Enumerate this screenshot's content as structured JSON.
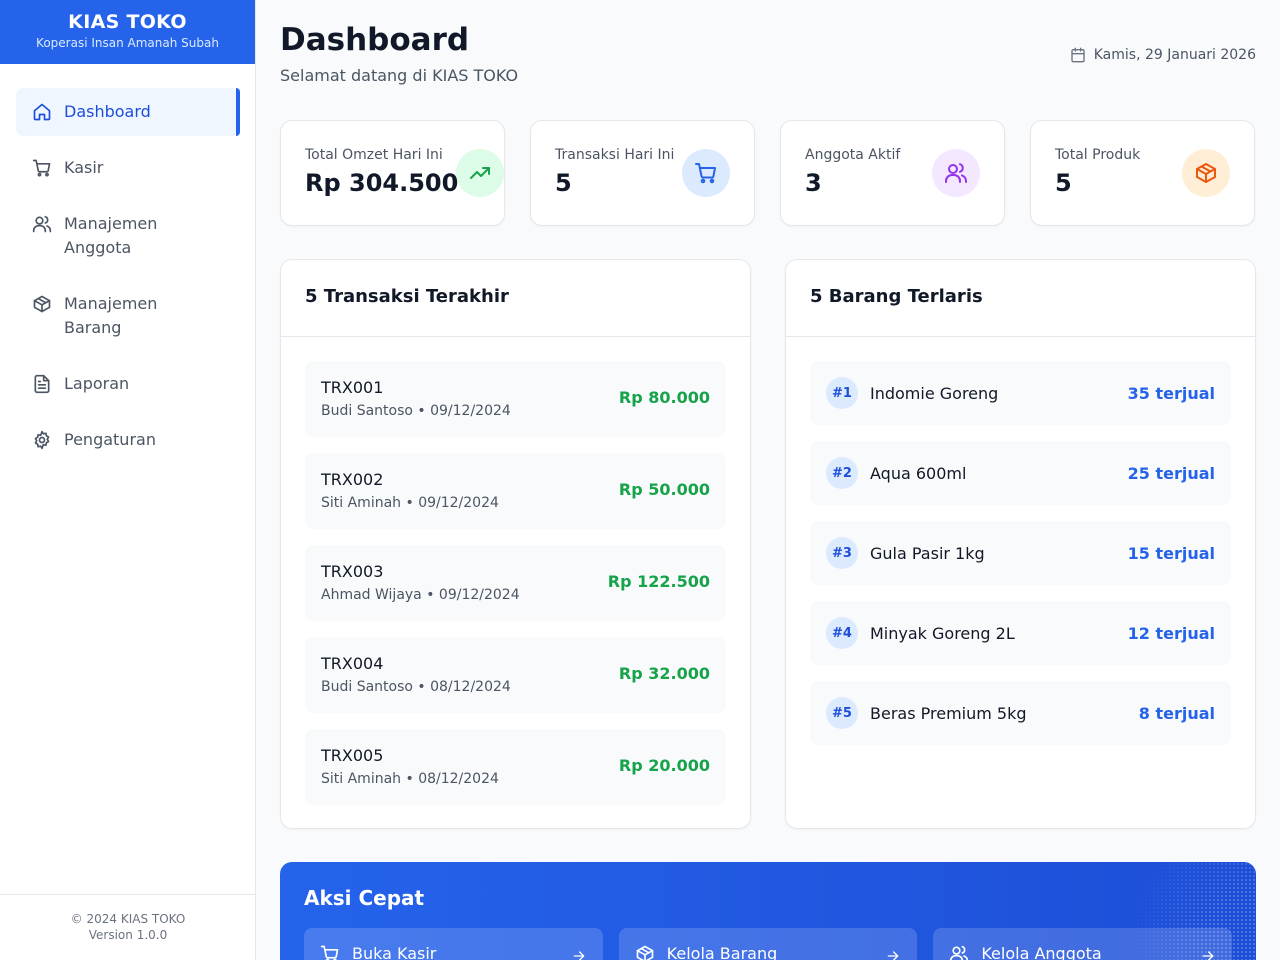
{
  "brand": {
    "title": "KIAS TOKO",
    "subtitle": "Koperasi Insan Amanah Subah"
  },
  "sidebar": {
    "items": [
      {
        "label": "Dashboard",
        "icon": "home-icon",
        "active": true
      },
      {
        "label": "Kasir",
        "icon": "cart-icon"
      },
      {
        "label": "Manajemen Anggota",
        "icon": "users-icon"
      },
      {
        "label": "Manajemen Barang",
        "icon": "box-icon"
      },
      {
        "label": "Laporan",
        "icon": "file-icon"
      },
      {
        "label": "Pengaturan",
        "icon": "gear-icon"
      }
    ],
    "footer": {
      "copyright": "© 2024 KIAS TOKO",
      "version": "Version 1.0.0"
    }
  },
  "header": {
    "title": "Dashboard",
    "subtitle": "Selamat datang di KIAS TOKO",
    "date": "Kamis, 29 Januari 2026"
  },
  "stats": [
    {
      "label": "Total Omzet Hari Ini",
      "value": "Rp 304.500",
      "icon": "trending-up-icon",
      "color": "#16a34a",
      "bg": "#dcfce7"
    },
    {
      "label": "Transaksi Hari Ini",
      "value": "5",
      "icon": "cart-icon",
      "color": "#2563eb",
      "bg": "#dbeafe"
    },
    {
      "label": "Anggota Aktif",
      "value": "3",
      "icon": "users-icon",
      "color": "#9333ea",
      "bg": "#f3e8ff"
    },
    {
      "label": "Total Produk",
      "value": "5",
      "icon": "box-icon",
      "color": "#ea580c",
      "bg": "#ffedd5"
    }
  ],
  "recent": {
    "title": "5 Transaksi Terakhir",
    "rows": [
      {
        "id": "TRX001",
        "meta": "Budi Santoso • 09/12/2024",
        "amount": "Rp 80.000"
      },
      {
        "id": "TRX002",
        "meta": "Siti Aminah • 09/12/2024",
        "amount": "Rp 50.000"
      },
      {
        "id": "TRX003",
        "meta": "Ahmad Wijaya • 09/12/2024",
        "amount": "Rp 122.500"
      },
      {
        "id": "TRX004",
        "meta": "Budi Santoso • 08/12/2024",
        "amount": "Rp 32.000"
      },
      {
        "id": "TRX005",
        "meta": "Siti Aminah • 08/12/2024",
        "amount": "Rp 20.000"
      }
    ]
  },
  "top": {
    "title": "5 Barang Terlaris",
    "rows": [
      {
        "rank": "#1",
        "name": "Indomie Goreng",
        "sold": "35 terjual"
      },
      {
        "rank": "#2",
        "name": "Aqua 600ml",
        "sold": "25 terjual"
      },
      {
        "rank": "#3",
        "name": "Gula Pasir 1kg",
        "sold": "15 terjual"
      },
      {
        "rank": "#4",
        "name": "Minyak Goreng 2L",
        "sold": "12 terjual"
      },
      {
        "rank": "#5",
        "name": "Beras Premium 5kg",
        "sold": "8 terjual"
      }
    ]
  },
  "quick": {
    "title": "Aksi Cepat",
    "actions": [
      {
        "label": "Buka Kasir",
        "icon": "cart-icon"
      },
      {
        "label": "Kelola Barang",
        "icon": "box-icon"
      },
      {
        "label": "Kelola Anggota",
        "icon": "users-icon"
      }
    ]
  }
}
